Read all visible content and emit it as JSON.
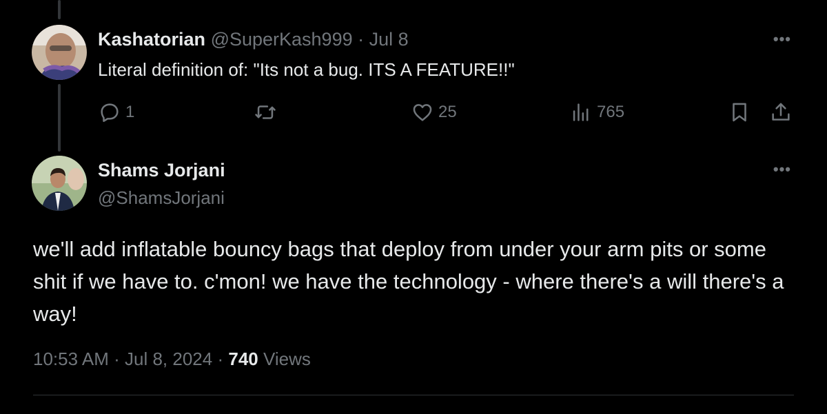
{
  "tweet1": {
    "display_name": "Kashatorian",
    "handle": "@SuperKash999",
    "separator": "·",
    "date": "Jul 8",
    "text": "Literal definition of: \"Its not a bug. ITS A FEATURE!!\"",
    "more_label": "•••",
    "actions": {
      "reply_count": "1",
      "retweet_count": "",
      "like_count": "25",
      "views_count": "765"
    }
  },
  "tweet2": {
    "display_name": "Shams Jorjani",
    "handle": "@ShamsJorjani",
    "more_label": "•••",
    "text": "we'll add inflatable bouncy bags that deploy from under your arm pits or some shit if we have to. c'mon! we have the technology - where there's a will there's a way!",
    "time": "10:53 AM",
    "separator": "·",
    "date": "Jul 8, 2024",
    "views_count": "740",
    "views_label": "Views"
  },
  "colors": {
    "background": "#000000",
    "text": "#e7e9ea",
    "muted": "#71767b",
    "divider": "#2f3336"
  },
  "icons": [
    "reply-icon",
    "retweet-icon",
    "like-icon",
    "views-icon",
    "bookmark-icon",
    "share-icon",
    "more-icon"
  ]
}
